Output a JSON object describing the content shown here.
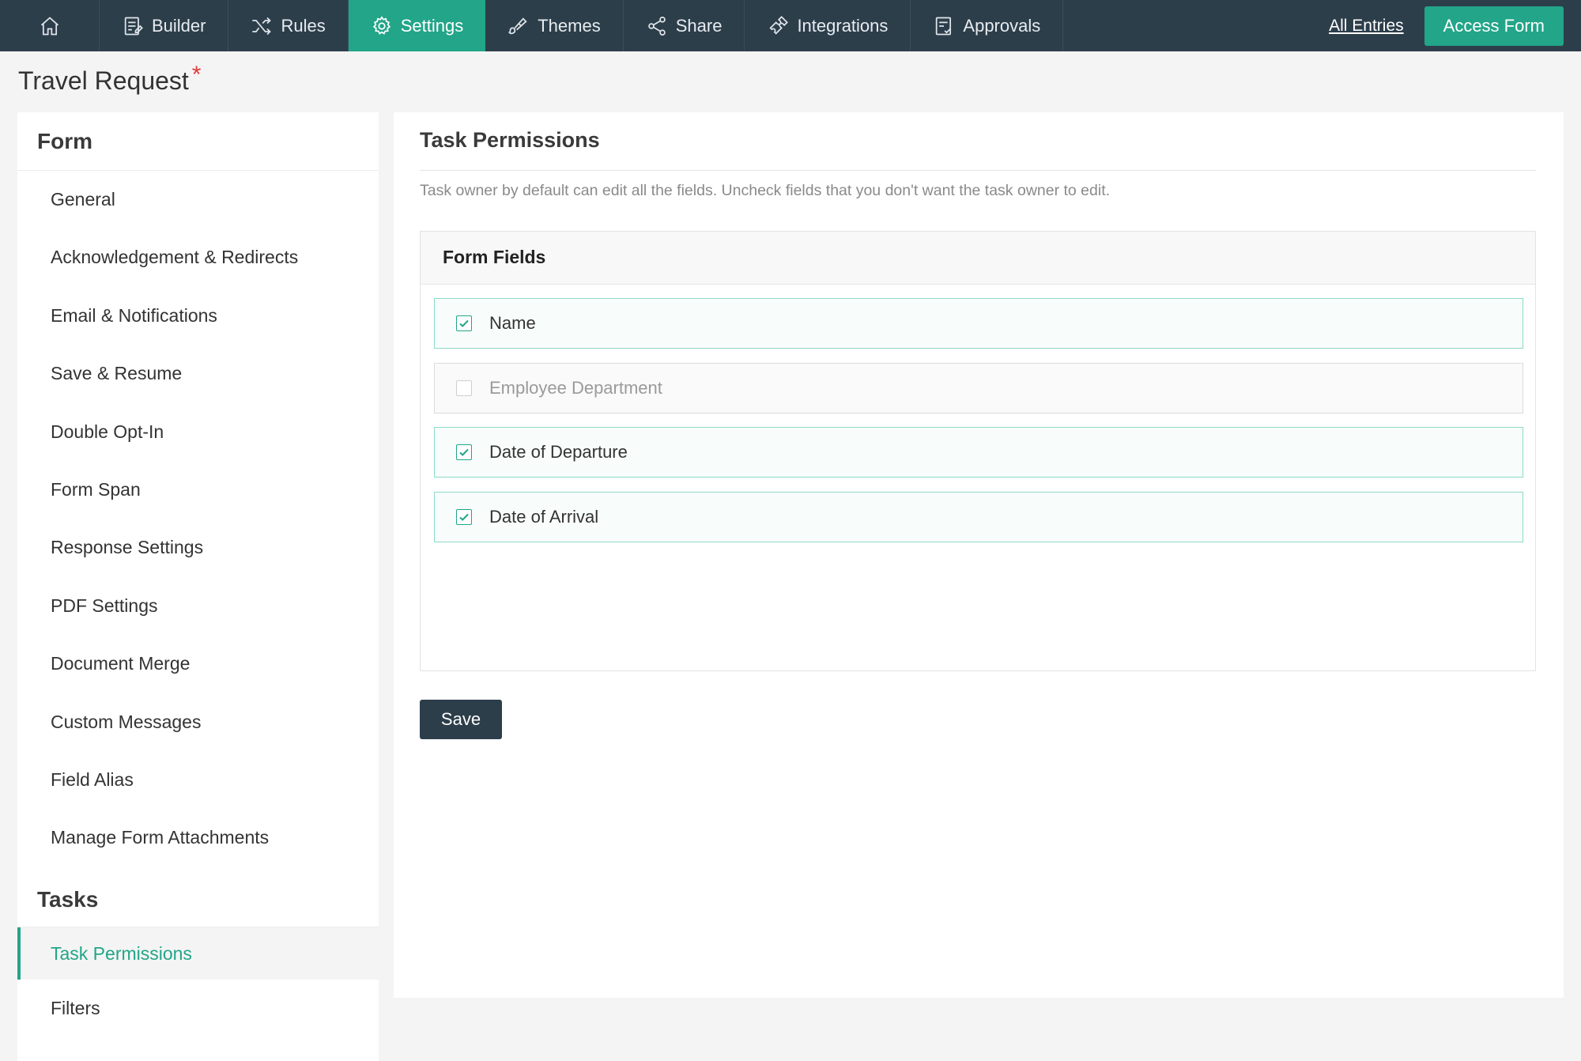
{
  "nav": {
    "items": [
      {
        "label": "Builder",
        "icon": "builder-icon"
      },
      {
        "label": "Rules",
        "icon": "shuffle-icon"
      },
      {
        "label": "Settings",
        "icon": "gear-icon",
        "active": true
      },
      {
        "label": "Themes",
        "icon": "brush-icon"
      },
      {
        "label": "Share",
        "icon": "share-icon"
      },
      {
        "label": "Integrations",
        "icon": "puzzle-icon"
      },
      {
        "label": "Approvals",
        "icon": "approvals-icon"
      }
    ],
    "all_entries": "All Entries",
    "access_form": "Access Form"
  },
  "form_title": "Travel Request",
  "form_title_marker": "*",
  "sidebar": {
    "form_section": "Form",
    "form_items": [
      "General",
      "Acknowledgement & Redirects",
      "Email & Notifications",
      "Save & Resume",
      "Double Opt-In",
      "Form Span",
      "Response Settings",
      "PDF Settings",
      "Document Merge",
      "Custom Messages",
      "Field Alias",
      "Manage Form Attachments"
    ],
    "tasks_section": "Tasks",
    "task_items": [
      "Task Permissions",
      "Filters"
    ],
    "active_item": "Task Permissions"
  },
  "main": {
    "title": "Task Permissions",
    "description": "Task owner by default can edit all the fields. Uncheck fields that you don't want the task owner to edit.",
    "fields_header": "Form Fields",
    "fields": [
      {
        "label": "Name",
        "checked": true
      },
      {
        "label": "Employee Department",
        "checked": false
      },
      {
        "label": "Date of Departure",
        "checked": true
      },
      {
        "label": "Date of Arrival",
        "checked": true
      }
    ],
    "save_label": "Save"
  },
  "colors": {
    "topbar": "#2d3e4b",
    "accent": "#22a588",
    "required": "#e03a3a"
  }
}
